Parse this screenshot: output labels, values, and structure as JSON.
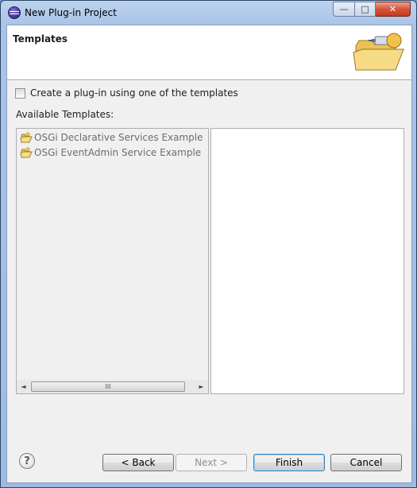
{
  "window": {
    "title": "New Plug-in Project",
    "controls": {
      "minimize": "—",
      "maximize": "□",
      "close": "✕"
    }
  },
  "banner": {
    "title": "Templates",
    "image_icon": "plugin-folder-wizard-icon"
  },
  "options": {
    "use_template_label": "Create a plug-in using one of the templates",
    "use_template_checked": false
  },
  "templates": {
    "label": "Available Templates:",
    "items": [
      {
        "label": "OSGi Declarative Services Example",
        "icon": "template-icon"
      },
      {
        "label": "OSGi EventAdmin Service Example",
        "icon": "template-icon"
      }
    ],
    "scroll": {
      "left": "◄",
      "right": "►",
      "grip": "III"
    }
  },
  "footer": {
    "help_label": "?",
    "back_label": "< Back",
    "next_label": "Next >",
    "finish_label": "Finish",
    "cancel_label": "Cancel"
  },
  "colors": {
    "title_bar": "#a9c4e6",
    "close_button": "#c7381d",
    "disabled_text": "#6d6d6d",
    "default_button_border": "#3c7fb1"
  }
}
